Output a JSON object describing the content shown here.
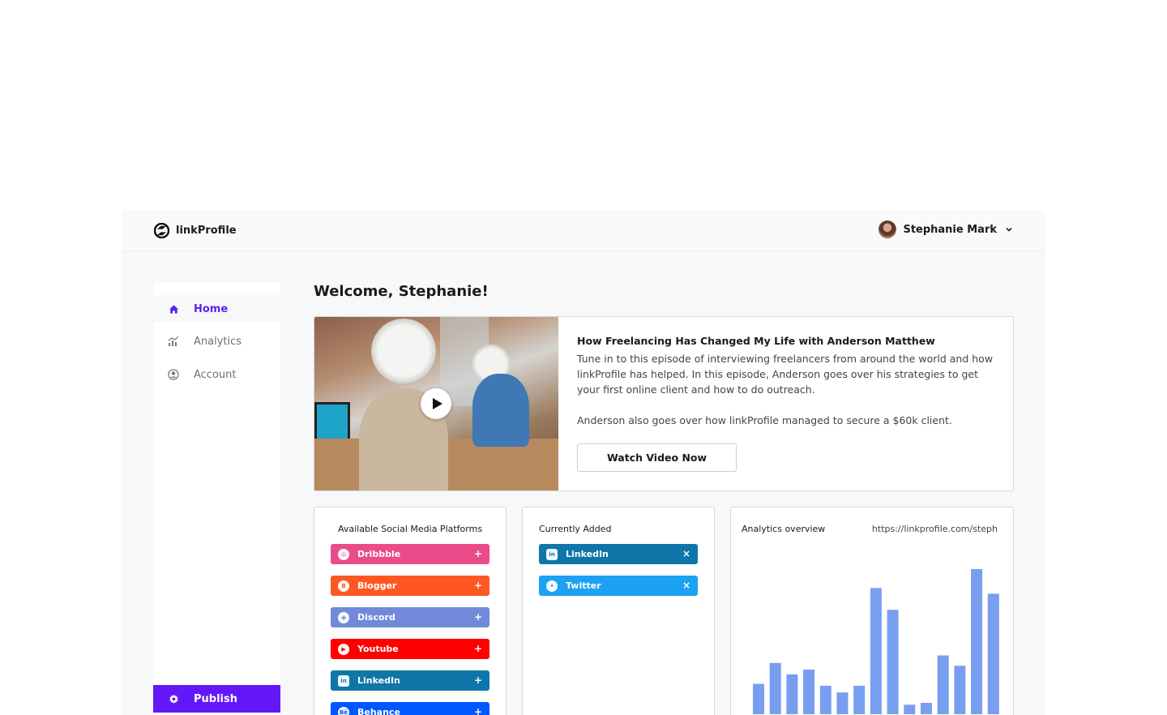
{
  "app": {
    "name": "linkProfile"
  },
  "user": {
    "name": "Stephanie Mark"
  },
  "sidebar": {
    "items": [
      {
        "label": "Home",
        "icon": "home-icon",
        "active": true
      },
      {
        "label": "Analytics",
        "icon": "analytics-icon",
        "active": false
      },
      {
        "label": "Account",
        "icon": "account-icon",
        "active": false
      }
    ],
    "publish_label": "Publish"
  },
  "main": {
    "welcome": "Welcome, Stephanie!",
    "video": {
      "title": "How Freelancing Has Changed My Life with Anderson Matthew",
      "description": "Tune in to this episode of interviewing freelancers from around the world and how linkProfile has helped. In this episode, Anderson goes over his strategies to get your first online client and how to do outreach.",
      "description2": "Anderson also goes over how linkProfile managed to secure a $60k client.",
      "button_label": "Watch Video Now"
    },
    "available": {
      "title": "Available Social Media Platforms",
      "platforms": [
        {
          "label": "Dribbble",
          "color": "#ea4c89",
          "icon": "dribbble-icon"
        },
        {
          "label": "Blogger",
          "color": "#ff5722",
          "icon": "blogger-icon"
        },
        {
          "label": "Discord",
          "color": "#7289da",
          "icon": "discord-icon"
        },
        {
          "label": "Youtube",
          "color": "#ff0000",
          "icon": "youtube-icon"
        },
        {
          "label": "LinkedIn",
          "color": "#0e76a8",
          "icon": "linkedin-icon"
        },
        {
          "label": "Behance",
          "color": "#0057ff",
          "icon": "behance-icon"
        }
      ],
      "action": "+"
    },
    "added": {
      "title": "Currently Added",
      "platforms": [
        {
          "label": "LinkedIn",
          "color": "#0e76a8",
          "icon": "linkedin-icon"
        },
        {
          "label": "Twitter",
          "color": "#1da1f2",
          "icon": "twitter-icon"
        }
      ],
      "action": "×"
    },
    "analytics": {
      "title": "Analytics overview",
      "url": "https://linkprofile.com/steph"
    }
  },
  "chart_data": {
    "type": "bar",
    "values": [
      32,
      54,
      42,
      47,
      30,
      23,
      30,
      133,
      110,
      10,
      12,
      62,
      51,
      153,
      127
    ],
    "color": "#789ef0"
  },
  "colors": {
    "accent": "#6417f9",
    "active_nav": "#5b21f5"
  }
}
